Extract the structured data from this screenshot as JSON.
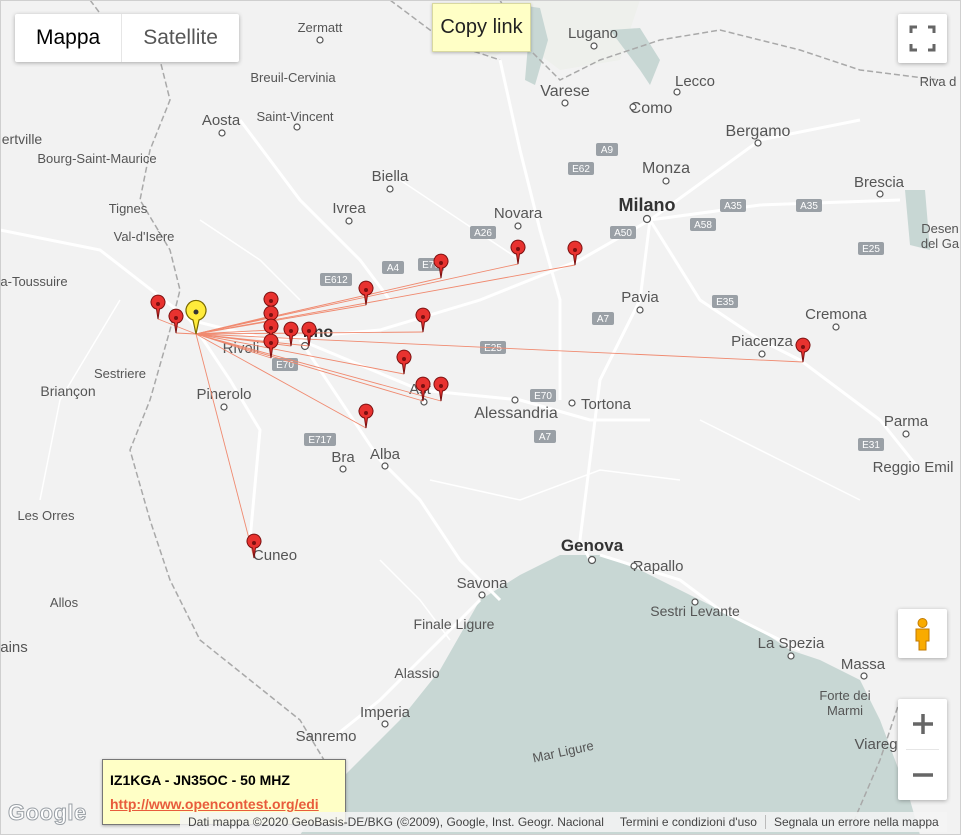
{
  "ui": {
    "maptype": {
      "map": "Mappa",
      "satellite": "Satellite",
      "selected": "map"
    },
    "copy_link": "Copy link",
    "info": {
      "title": "IZ1KGA - JN35OC - 50 MHZ",
      "link": "http://www.opencontest.org/edi"
    },
    "attribution": {
      "data": "Dati mappa ©2020 GeoBasis-DE/BKG (©2009), Google, Inst. Geogr. Nacional",
      "terms": "Termini e condizioni d'uso",
      "report": "Segnala un errore nella mappa"
    },
    "logo": "Google",
    "icons": {
      "fullscreen": "fullscreen-icon",
      "pegman": "pegman-icon",
      "zoom_in": "zoom-in-icon",
      "zoom_out": "zoom-out-icon"
    }
  },
  "colors": {
    "land": "#f2f2f2",
    "sea": "#c8d7d4",
    "line": "#f08a70",
    "marker_red": "#e8322f",
    "marker_home": "#ffeb3b"
  },
  "labels": {
    "places": [
      "Zermatt",
      "Lugano",
      "Breuil-Cervinia",
      "Varese",
      "Lecco",
      "Riva d",
      "Aosta",
      "Saint-Vincent",
      "Como",
      "ertville",
      "Bergamo",
      "Bourg-Saint-Maurice",
      "Biella",
      "Monza",
      "Brescia",
      "Tignes",
      "Ivrea",
      "Novara",
      "Milano",
      "Val-d'Isère",
      "Desen",
      "del Ga",
      "a-Toussuire",
      "Pavia",
      "Cremona",
      "Rivoli",
      "Piacenza",
      "Sestriere",
      "Briançon",
      "Pinerolo",
      "Tortona",
      "Alessandria",
      "Parma",
      "Reggio Emil",
      "Bra",
      "Alba",
      "Les Orres",
      "Genova",
      "Rapallo",
      "Cuneo",
      "Savona",
      "Sestri Levante",
      "Allos",
      "ains",
      "Finale Ligure",
      "La Spezia",
      "Massa",
      "Alassio",
      "Forte dei",
      "Marmi",
      "Imperia",
      "Viareg",
      "Sanremo",
      "Mar Ligure",
      "rino",
      "Ast"
    ],
    "roads": [
      "A9",
      "E62",
      "A35",
      "A35",
      "A26",
      "A58",
      "A50",
      "E25",
      "E612",
      "A4",
      "E70",
      "A7",
      "E35",
      "E25",
      "E70",
      "E70",
      "A7",
      "E717",
      "E31"
    ]
  }
}
